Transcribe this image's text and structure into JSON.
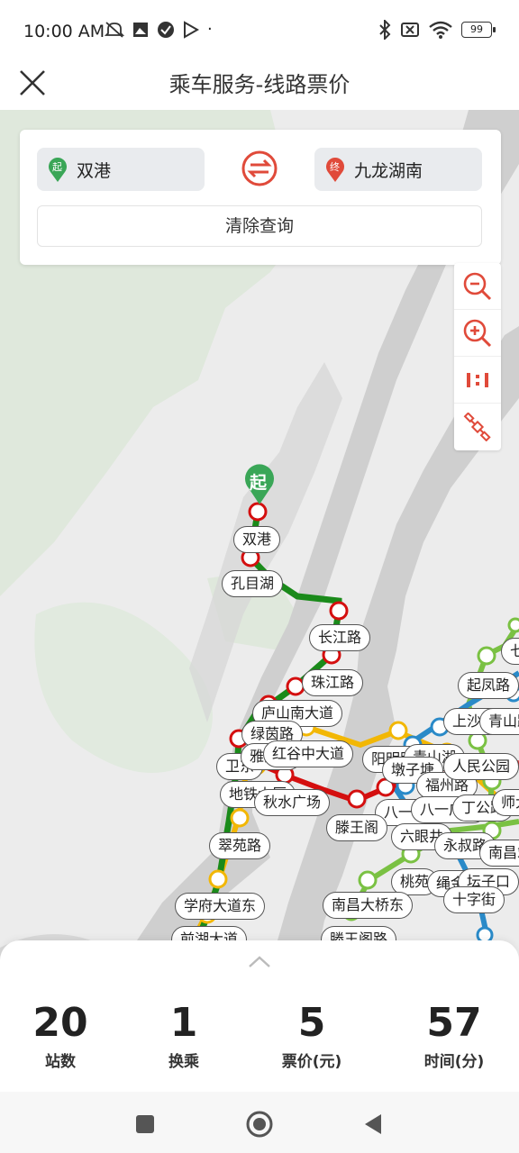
{
  "status": {
    "time": "10:00 AM",
    "battery": "99"
  },
  "header": {
    "title": "乘车服务-线路票价"
  },
  "query": {
    "start_badge": "起",
    "start_station": "双港",
    "end_badge": "终",
    "end_station": "九龙湖南",
    "clear_label": "清除查询"
  },
  "map": {
    "start_marker": "起",
    "station_labels": [
      "双港",
      "孔目湖",
      "长江路",
      "珠江路",
      "庐山南大道",
      "绿茵路",
      "卫东",
      "雅苑路",
      "红谷中大道",
      "地铁大厦",
      "秋水广场",
      "翠苑路",
      "学府大道东",
      "前湖大道",
      "阳明路",
      "青山湖",
      "墩子塘",
      "福州路",
      "八一馆",
      "八一广场",
      "滕王阁",
      "六眼井",
      "永叔路",
      "丁公路",
      "桃苑",
      "绳金塔",
      "坛子口",
      "十字街",
      "南昌大桥东",
      "滕王阁路",
      "上沙沟",
      "青山路",
      "起凤路",
      "人民公园",
      "师大",
      "南昌站",
      "七里"
    ]
  },
  "summary": {
    "stations": {
      "value": "20",
      "label": "站数"
    },
    "transfers": {
      "value": "1",
      "label": "换乘"
    },
    "fare": {
      "value": "5",
      "label": "票价(元)"
    },
    "time": {
      "value": "57",
      "label": "时间(分)"
    }
  },
  "colors": {
    "line1": "#d40f0f",
    "line2": "#1a8a1a",
    "line3": "#f2b705",
    "line4": "#7ac143",
    "line5": "#2a8ac8",
    "accent": "#e04a3a",
    "start_green": "#3aa657"
  },
  "icons": {
    "close": "close-icon",
    "swap": "swap-icon",
    "zoom_out": "zoom-out-icon",
    "zoom_in": "zoom-in-icon",
    "scale": "scale-icon",
    "satellite": "satellite-icon"
  }
}
